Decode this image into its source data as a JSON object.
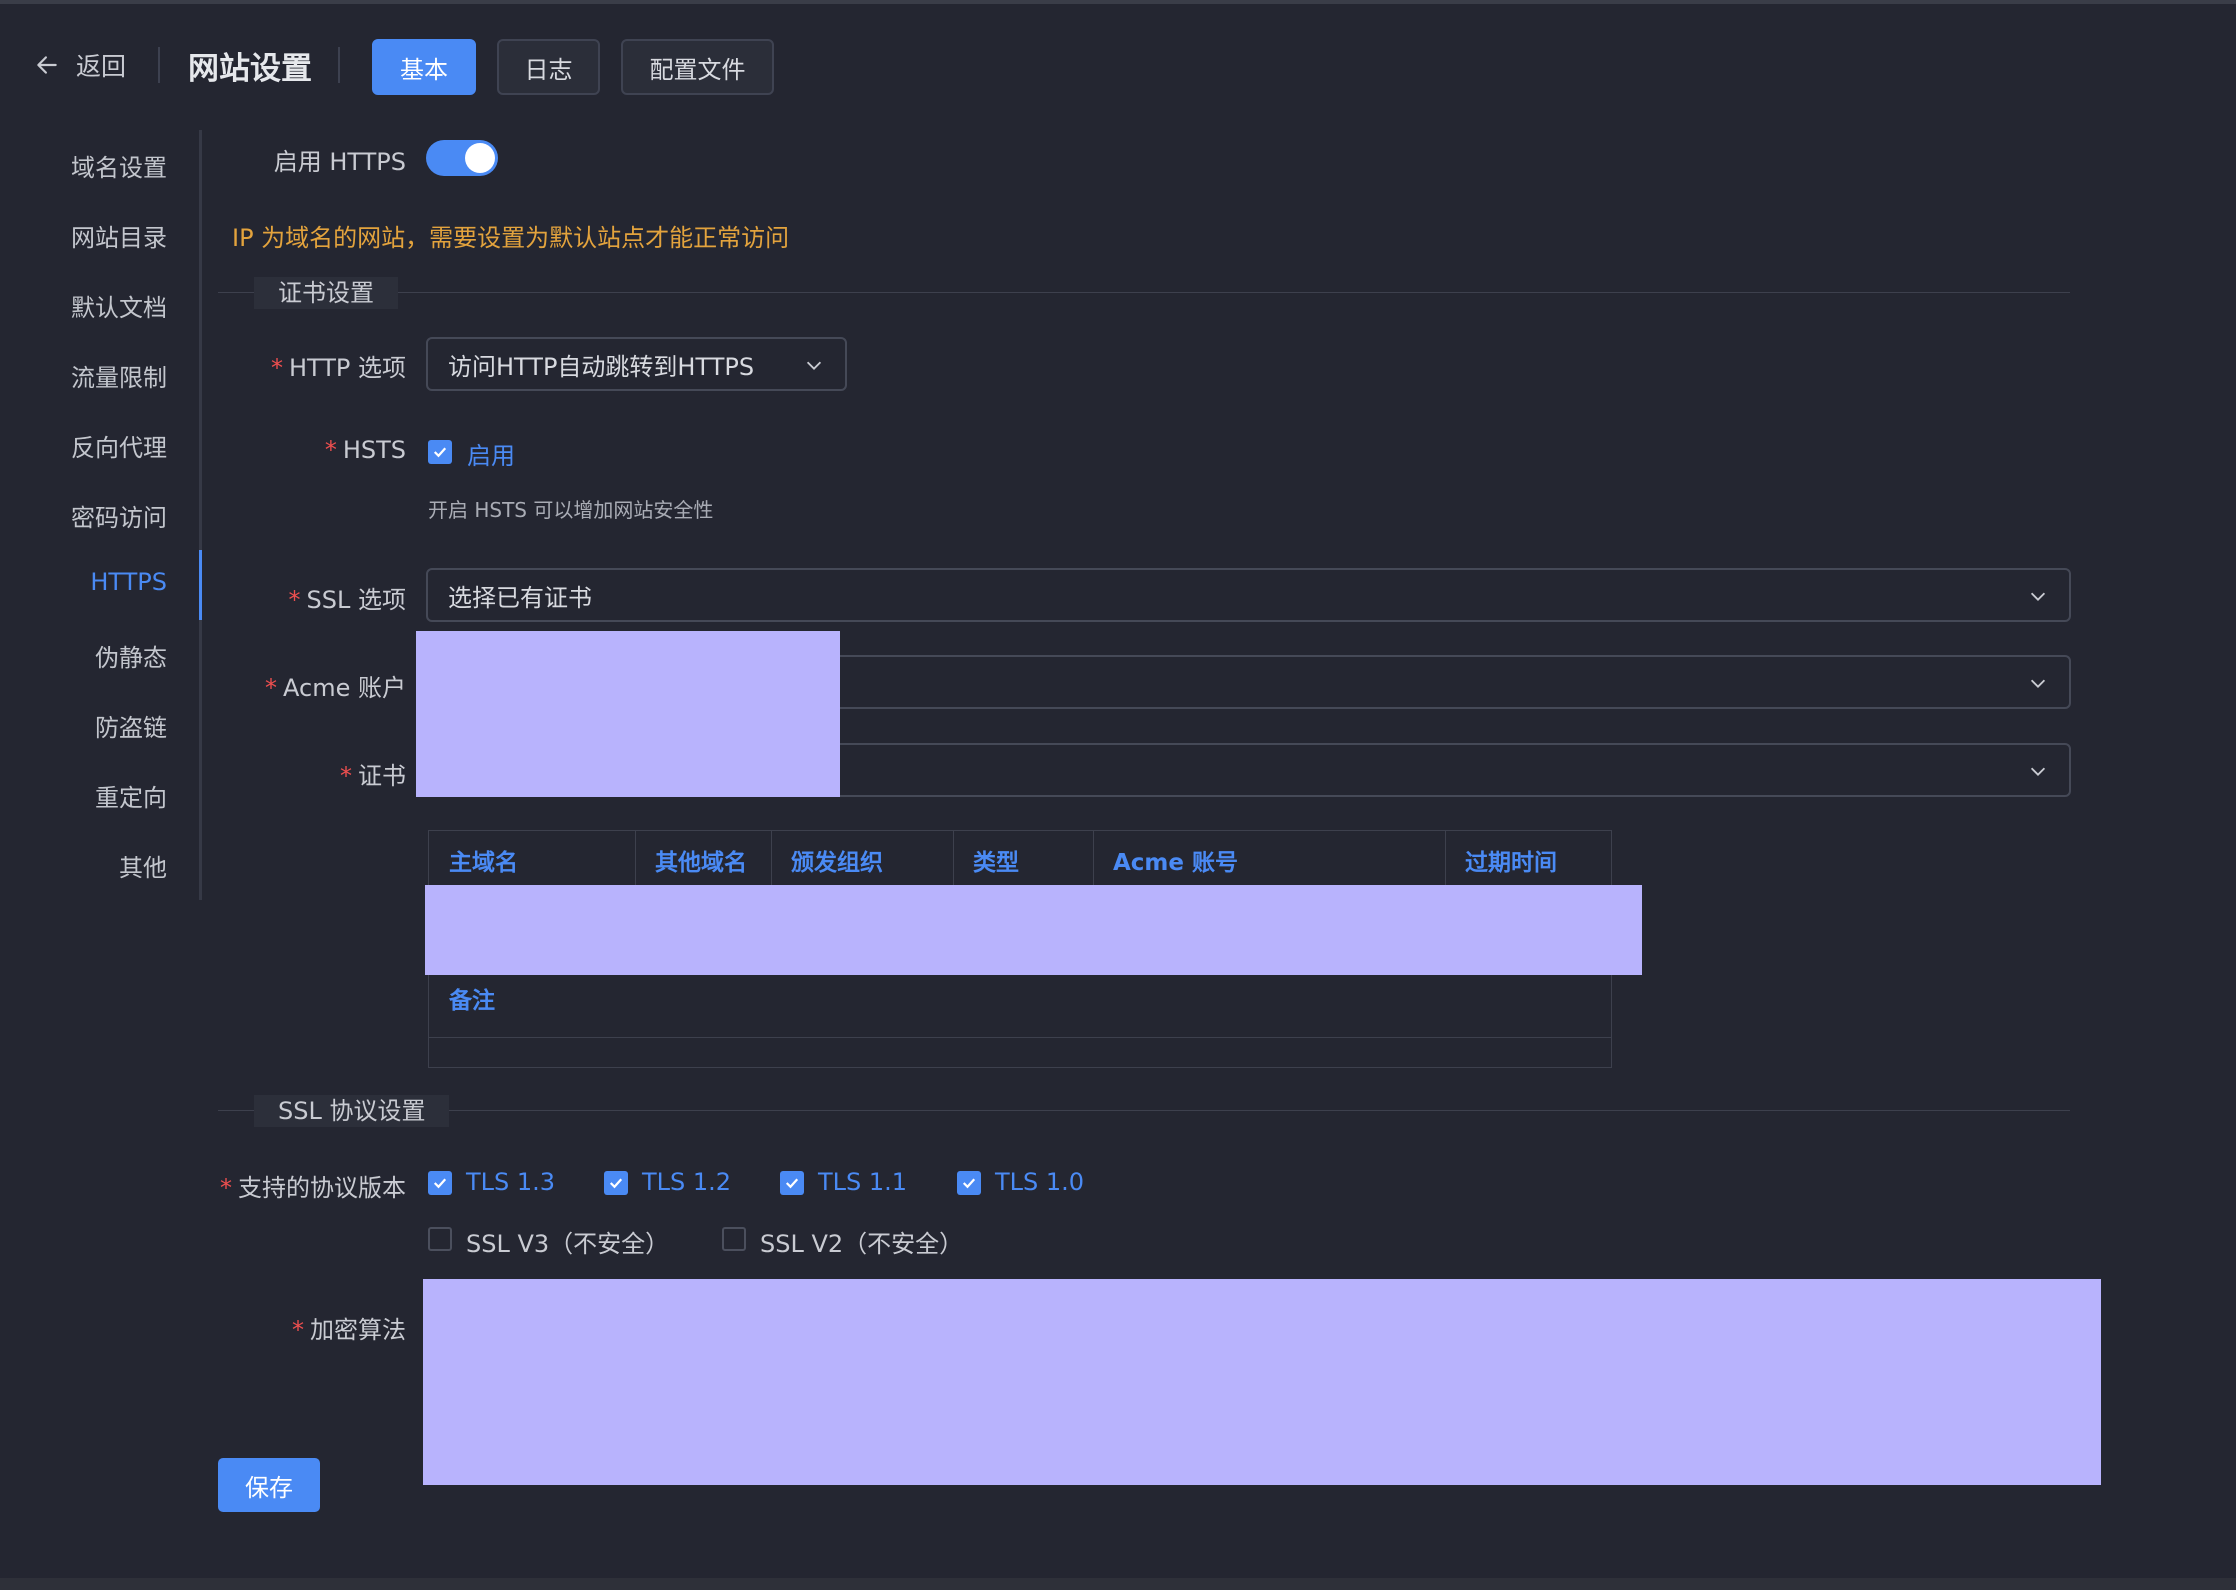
{
  "header": {
    "back_label": "返回",
    "page_title": "网站设置",
    "tabs": [
      {
        "label": "基本",
        "active": true
      },
      {
        "label": "日志",
        "active": false
      },
      {
        "label": "配置文件",
        "active": false
      }
    ]
  },
  "sidebar": {
    "items": [
      {
        "label": "域名设置",
        "active": false
      },
      {
        "label": "网站目录",
        "active": false
      },
      {
        "label": "默认文档",
        "active": false
      },
      {
        "label": "流量限制",
        "active": false
      },
      {
        "label": "反向代理",
        "active": false
      },
      {
        "label": "密码访问",
        "active": false
      },
      {
        "label": "HTTPS",
        "active": true
      },
      {
        "label": "伪静态",
        "active": false
      },
      {
        "label": "防盗链",
        "active": false
      },
      {
        "label": "重定向",
        "active": false
      },
      {
        "label": "其他",
        "active": false
      }
    ]
  },
  "https": {
    "enable_label": "启用 HTTPS",
    "enabled": true,
    "warning": "IP 为域名的网站，需要设置为默认站点才能正常访问"
  },
  "cert_section": {
    "title": "证书设置",
    "http_option_label": "HTTP 选项",
    "http_option_value": "访问HTTP自动跳转到HTTPS",
    "hsts_label": "HSTS",
    "hsts_checkbox_label": "启用",
    "hsts_checked": true,
    "hsts_hint": "开启 HSTS 可以增加网站安全性",
    "ssl_option_label": "SSL 选项",
    "ssl_option_value": "选择已有证书",
    "acme_label": "Acme 账户",
    "cert_label": "证书",
    "table": {
      "headers": [
        "主域名",
        "其他域名",
        "颁发组织",
        "类型",
        "Acme 账号",
        "过期时间"
      ],
      "remark_header": "备注"
    }
  },
  "ssl_section": {
    "title": "SSL 协议设置",
    "protocols_label": "支持的协议版本",
    "protocols": [
      {
        "label": "TLS 1.3",
        "checked": true
      },
      {
        "label": "TLS 1.2",
        "checked": true
      },
      {
        "label": "TLS 1.1",
        "checked": true
      },
      {
        "label": "TLS 1.0",
        "checked": true
      },
      {
        "label": "SSL V3（不安全）",
        "checked": false
      },
      {
        "label": "SSL V2（不安全）",
        "checked": false
      }
    ],
    "cipher_label": "加密算法"
  },
  "save_label": "保存",
  "colors": {
    "accent": "#4a8af4",
    "warning": "#e3a33d",
    "required": "#ee4f4f",
    "background": "#242631",
    "redaction": "#b8b3fd"
  }
}
